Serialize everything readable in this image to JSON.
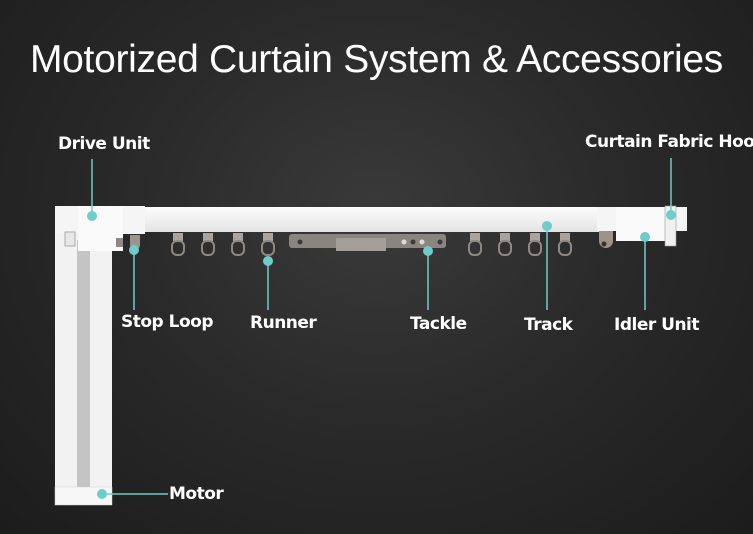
{
  "title": "Motorized Curtain System & Accessories",
  "accent_color": "#6ecdc8",
  "labels": {
    "drive_unit": "Drive Unit",
    "curtain_fabric_hook": "Curtain Fabric Hook",
    "stop_loop": "Stop Loop",
    "runner": "Runner",
    "tackle": "Tackle",
    "track": "Track",
    "idler_unit": "Idler Unit",
    "motor": "Motor"
  }
}
